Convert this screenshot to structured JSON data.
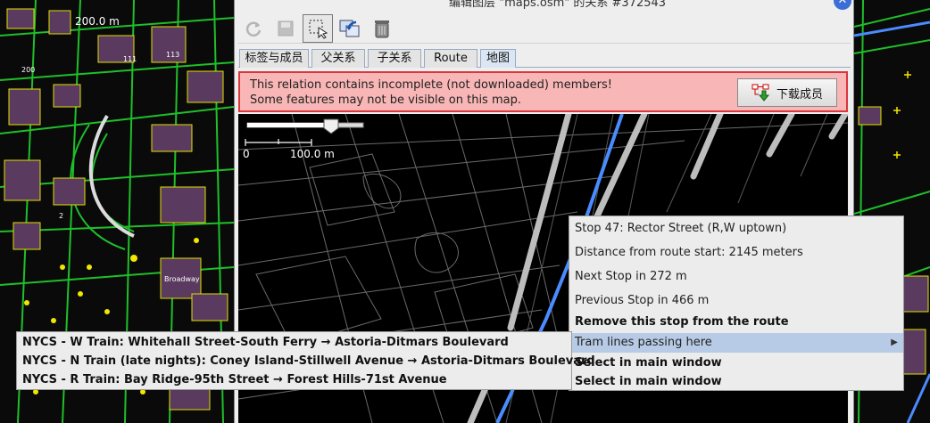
{
  "window": {
    "title": "编辑图层 \"maps.osm\" 的关系 #372543",
    "close_icon": "close-icon"
  },
  "left_map": {
    "scale_label": "200.0 m",
    "labels": [
      "Broadway",
      "113",
      "111",
      "200",
      "2"
    ]
  },
  "toolbar": {
    "buttons": [
      {
        "name": "refresh-icon",
        "state": "disabled"
      },
      {
        "name": "save-icon",
        "state": "disabled"
      },
      {
        "name": "select-icon",
        "state": "active"
      },
      {
        "name": "zoom-to-icon",
        "state": "normal"
      },
      {
        "name": "delete-icon",
        "state": "normal"
      }
    ]
  },
  "tabs": [
    {
      "label": "标签与成员",
      "selected": false
    },
    {
      "label": "父关系",
      "selected": false
    },
    {
      "label": "子关系",
      "selected": false
    },
    {
      "label": "Route",
      "selected": false
    },
    {
      "label": "地图",
      "selected": true
    }
  ],
  "warning": {
    "line1": "This relation contains incomplete (not downloaded) members!",
    "line2": "Some features may not be visible on this map.",
    "button_label": "下载成员",
    "button_icon": "download-members-icon"
  },
  "map": {
    "scale_zero": "0",
    "scale_label": "100.0 m",
    "zoom_level": 0.27
  },
  "context_menu": {
    "items": [
      {
        "label": "Stop 47: Rector Street (R,W uptown)",
        "bold": false
      },
      {
        "label": "Distance from route start: 2145 meters",
        "bold": false
      },
      {
        "label": "Next Stop in 272 m",
        "bold": false
      },
      {
        "label": "Previous Stop in 466 m",
        "bold": false
      },
      {
        "label": "Remove this stop from the route",
        "bold": true
      },
      {
        "label": "Tram lines passing here",
        "bold": false,
        "highlight": true,
        "submenu": true
      },
      {
        "label": "Select in main window",
        "bold": true
      },
      {
        "label": "Select in main window",
        "bold": true
      }
    ]
  },
  "sub_menu": {
    "items": [
      "NYCS - W Train: Whitehall Street-South Ferry → Astoria-Ditmars Boulevard",
      "NYCS - N Train (late nights): Coney Island-Stillwell Avenue → Astoria-Ditmars Boulevard",
      "NYCS - R Train: Bay Ridge-95th Street → Forest Hills-71st Avenue"
    ]
  },
  "colors": {
    "warning_bg": "#f8b6b6",
    "warning_border": "#d9363e",
    "menu_highlight": "#b8cbe6",
    "route_blue": "#4a8cff",
    "osm_yellow": "#f2e600",
    "osm_green": "#1fbf2a"
  }
}
